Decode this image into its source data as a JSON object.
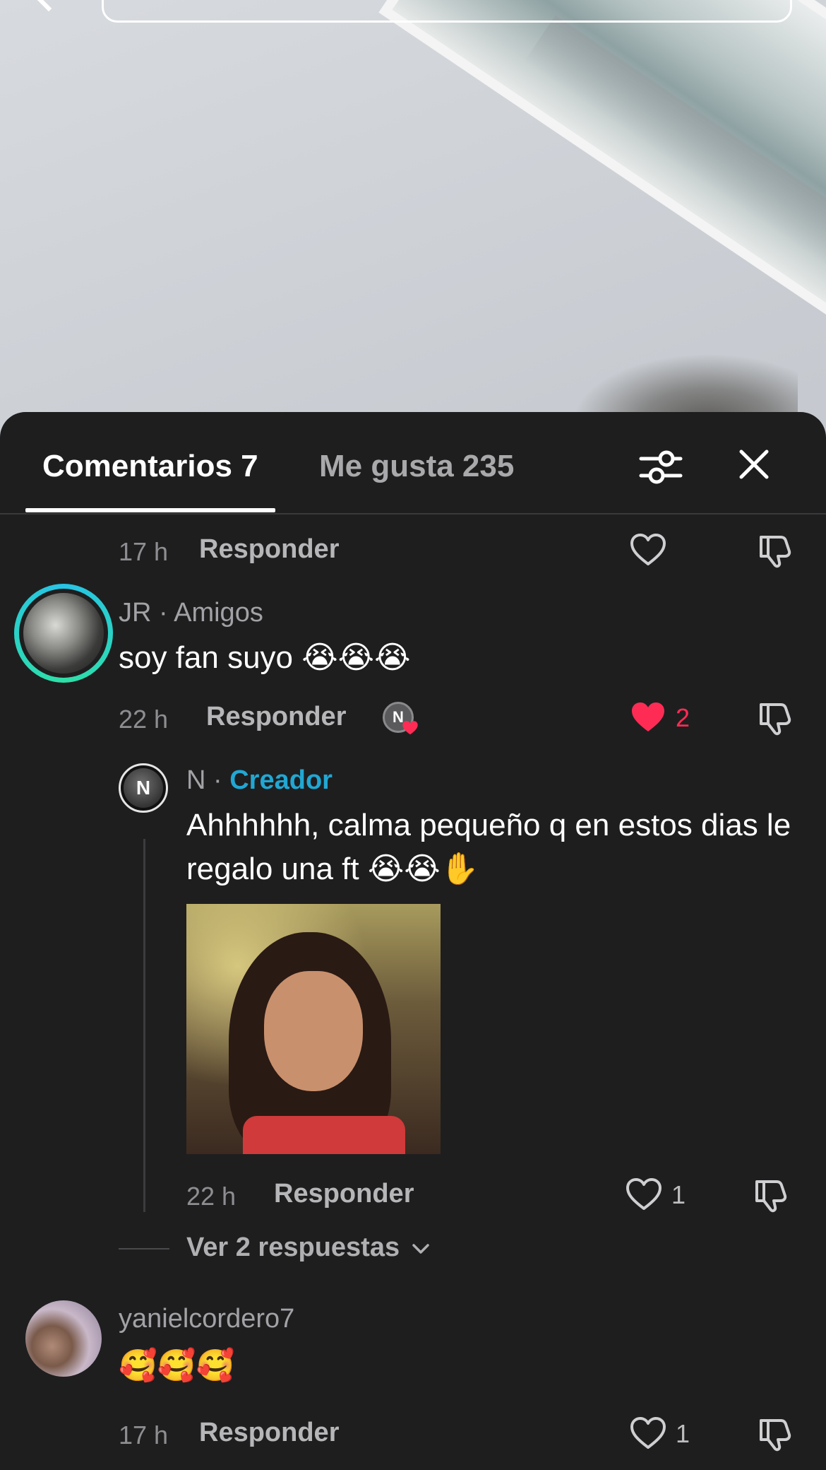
{
  "tabs": {
    "comments_label": "Comentarios 7",
    "likes_label": "Me gusta 235"
  },
  "comments": [
    {
      "time": "17 h",
      "reply_label": "Responder",
      "like_count": ""
    },
    {
      "username": "JR · Amigos",
      "text": "soy fan suyo 😭😭😭",
      "time": "22 h",
      "reply_label": "Responder",
      "like_count": "2",
      "liked_by_creator_badge": "N",
      "reply": {
        "username": "N",
        "separator": " · ",
        "role": "Creador",
        "avatar_letter": "N",
        "text": "Ahhhhhh, calma pequeño q en estos dias le regalo una ft 😭😭✋",
        "time": "22 h",
        "reply_label": "Responder",
        "like_count": "1"
      },
      "more_replies_label": "Ver 2 respuestas"
    },
    {
      "username": "yanielcordero7",
      "text": "🥰🥰🥰",
      "time": "17 h",
      "reply_label": "Responder",
      "like_count": "1"
    }
  ],
  "colors": {
    "sheet_bg": "#1e1e1f",
    "liked_heart": "#fe2c55",
    "creator_label": "#21a7d3",
    "friend_ring_start": "#27c3e6",
    "friend_ring_end": "#2ee0a6"
  },
  "icons": {
    "filter": "sliders-icon",
    "close": "close-icon",
    "heart": "heart-icon",
    "dislike": "thumbs-down-icon",
    "chevron": "chevron-down-icon"
  }
}
